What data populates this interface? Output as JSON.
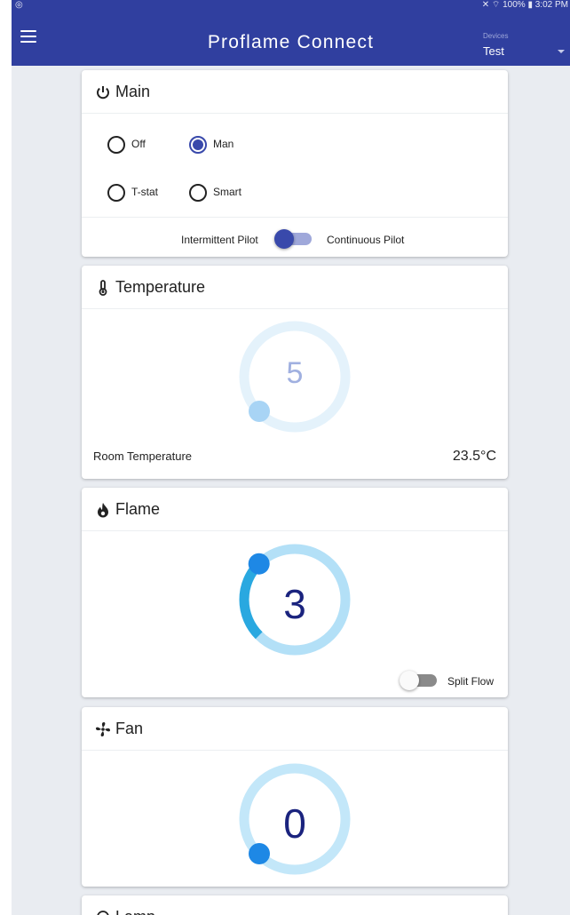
{
  "status_bar": {
    "icons_left": "notification-icon",
    "right_text": "100% ▮ 3:02 PM"
  },
  "app": {
    "title": "Proflame Connect",
    "devices_label": "Devices",
    "device_selected": "Test"
  },
  "main": {
    "title": "Main",
    "modes": [
      {
        "label": "Off",
        "selected": false
      },
      {
        "label": "Man",
        "selected": true
      },
      {
        "label": "T-stat",
        "selected": false
      },
      {
        "label": "Smart",
        "selected": false
      }
    ],
    "pilot_left": "Intermittent Pilot",
    "pilot_right": "Continuous Pilot",
    "pilot_continuous": false
  },
  "temperature": {
    "title": "Temperature",
    "dial_value": "5",
    "room_label": "Room Temperature",
    "room_value": "23.5°C"
  },
  "flame": {
    "title": "Flame",
    "dial_value": "3",
    "level_fraction": 0.4,
    "split_flow_label": "Split Flow",
    "split_flow_on": false
  },
  "fan": {
    "title": "Fan",
    "dial_value": "0"
  },
  "lamp": {
    "title": "Lamp"
  },
  "colors": {
    "primary": "#303f9f",
    "accent": "#3949ab",
    "dial_blue": "#1e88e5",
    "dial_track": "#b3e0f7"
  }
}
